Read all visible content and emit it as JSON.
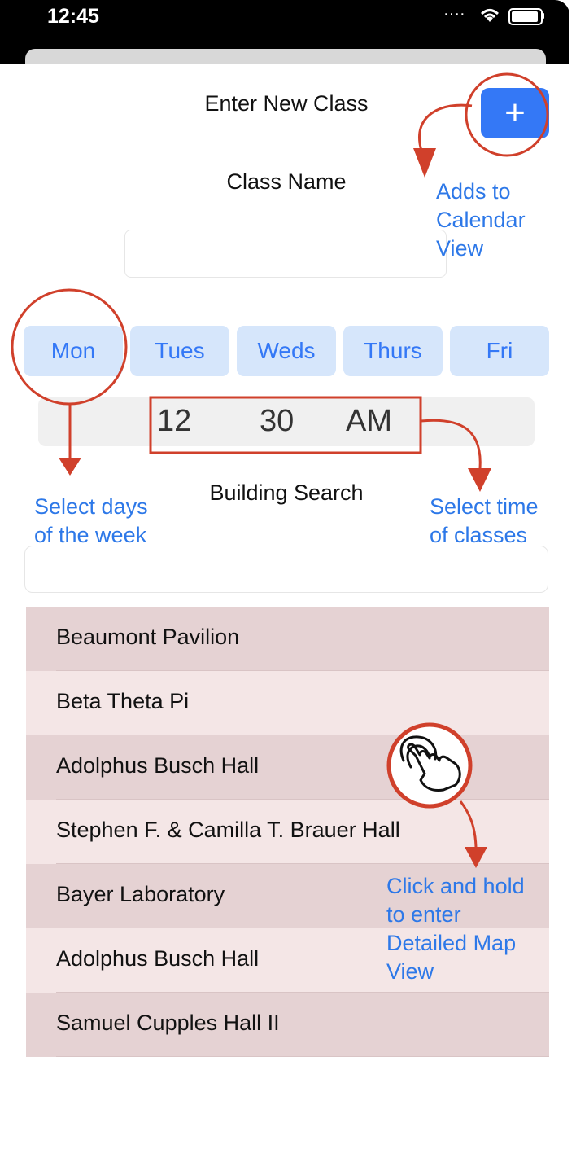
{
  "status": {
    "time": "12:45"
  },
  "header": {
    "title": "Enter New Class",
    "add_label": "+"
  },
  "form": {
    "class_name_label": "Class Name",
    "days": [
      "Mon",
      "Tues",
      "Weds",
      "Thurs",
      "Fri"
    ],
    "time": {
      "hour": "12",
      "minute": "30",
      "period": "AM"
    },
    "building_search_label": "Building Search"
  },
  "buildings": [
    "Beaumont Pavilion",
    "Beta Theta Pi",
    "Adolphus Busch Hall",
    "Stephen F. & Camilla T. Brauer Hall",
    "Bayer Laboratory",
    "Adolphus Busch Hall",
    "Samuel Cupples Hall II"
  ],
  "annotations": {
    "add": [
      "Adds to",
      "Calendar",
      "View"
    ],
    "days": [
      "Select days",
      "of the week"
    ],
    "time": [
      "Select time",
      "of classes"
    ],
    "map": [
      "Click and hold",
      "to enter",
      "Detailed Map",
      "View"
    ]
  },
  "colors": {
    "accent": "#3478f6",
    "annotation_red": "#d0402b",
    "annotation_blue": "#2d78e8",
    "row_dark": "#e5d2d3",
    "row_light": "#f4e6e6"
  }
}
